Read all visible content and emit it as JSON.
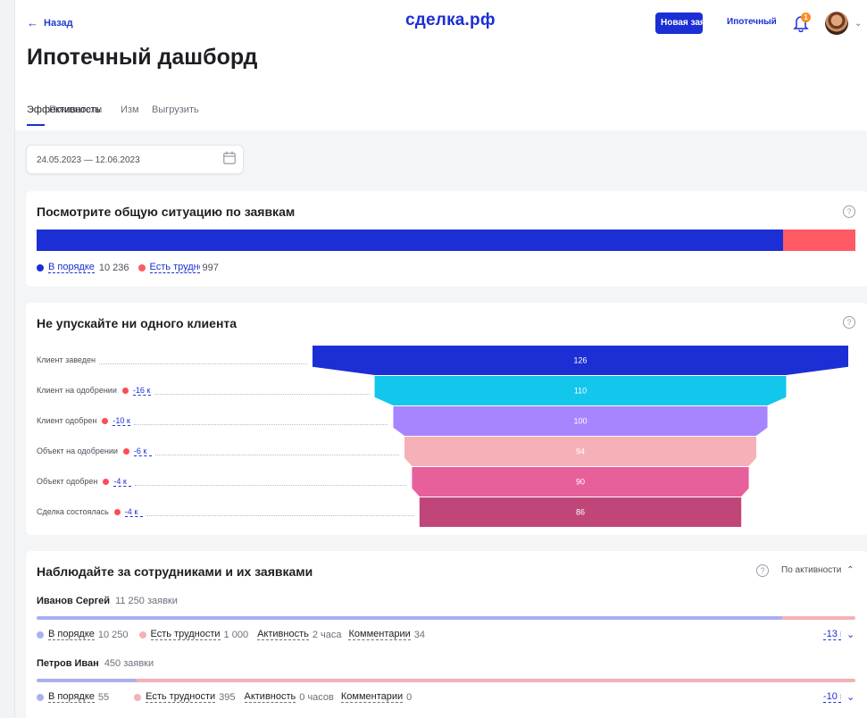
{
  "header": {
    "back_label": "Назад",
    "logo": "сделка.рф",
    "new_button": "Новая заявка",
    "mortgage_link": "Ипотечный",
    "notifications_count": "1"
  },
  "page_title": "Ипотечный дашборд",
  "tabs": [
    {
      "label": "Эффективность",
      "active": true
    },
    {
      "label": "Показатели",
      "active": false
    },
    {
      "label": "Изменения",
      "active": false
    },
    {
      "label": "Выгрузить",
      "active": false
    }
  ],
  "date_range": "24.05.2023 — 12.06.2023",
  "overview": {
    "title": "Посмотрите общую ситуацию по заявкам",
    "ok_label": "В порядке",
    "ok_value": "10 236",
    "ok_count": 10236,
    "bad_label": "Есть трудности",
    "bad_value": "997",
    "bad_count": 997,
    "ok_color": "#1b2fd4",
    "bad_color": "#ff5a64"
  },
  "funnel": {
    "title": "Не упускайте ни одного клиента",
    "stages": [
      {
        "label": "Клиент заведен",
        "delta": "",
        "value": "126",
        "color": "#1b2fd4"
      },
      {
        "label": "Клиент на одобрении",
        "delta": "-16 к",
        "value": "110",
        "color": "#13c6ec"
      },
      {
        "label": "Клиент одобрен",
        "delta": "-10 к",
        "value": "100",
        "color": "#a685ff"
      },
      {
        "label": "Объект на одобрении",
        "delta": "-6 к",
        "value": "94",
        "color": "#f5b0b8"
      },
      {
        "label": "Объект одобрен",
        "delta": "-4 к",
        "value": "90",
        "color": "#e8609b"
      },
      {
        "label": "Сделка состоялась",
        "delta": "-4 к",
        "value": "86",
        "color": "#c04679"
      }
    ]
  },
  "employees": {
    "title": "Наблюдайте за сотрудниками и их заявками",
    "sort_label": "По активности",
    "items": [
      {
        "name": "Иванов Сергей",
        "requests": "11 250 заявки",
        "ok_label": "В порядке",
        "ok_value": "10 250",
        "ok_count": 10250,
        "bad_label": "Есть трудности",
        "bad_value": "1 000",
        "bad_count": 1000,
        "activity_label": "Активность",
        "activity_value": "2 часа",
        "comments_label": "Комментарии",
        "comments_value": "34",
        "delta": "-13 к"
      },
      {
        "name": "Петров Иван",
        "requests": "450 заявки",
        "ok_label": "В порядке",
        "ok_value": "55",
        "ok_count": 55,
        "bad_label": "Есть трудности",
        "bad_value": "395",
        "bad_count": 395,
        "activity_label": "Активность",
        "activity_value": "0 часов",
        "comments_label": "Комментарии",
        "comments_value": "0",
        "delta": "-10 к"
      }
    ],
    "ok_color": "#a9b0f0",
    "bad_color": "#f4b2b6"
  }
}
